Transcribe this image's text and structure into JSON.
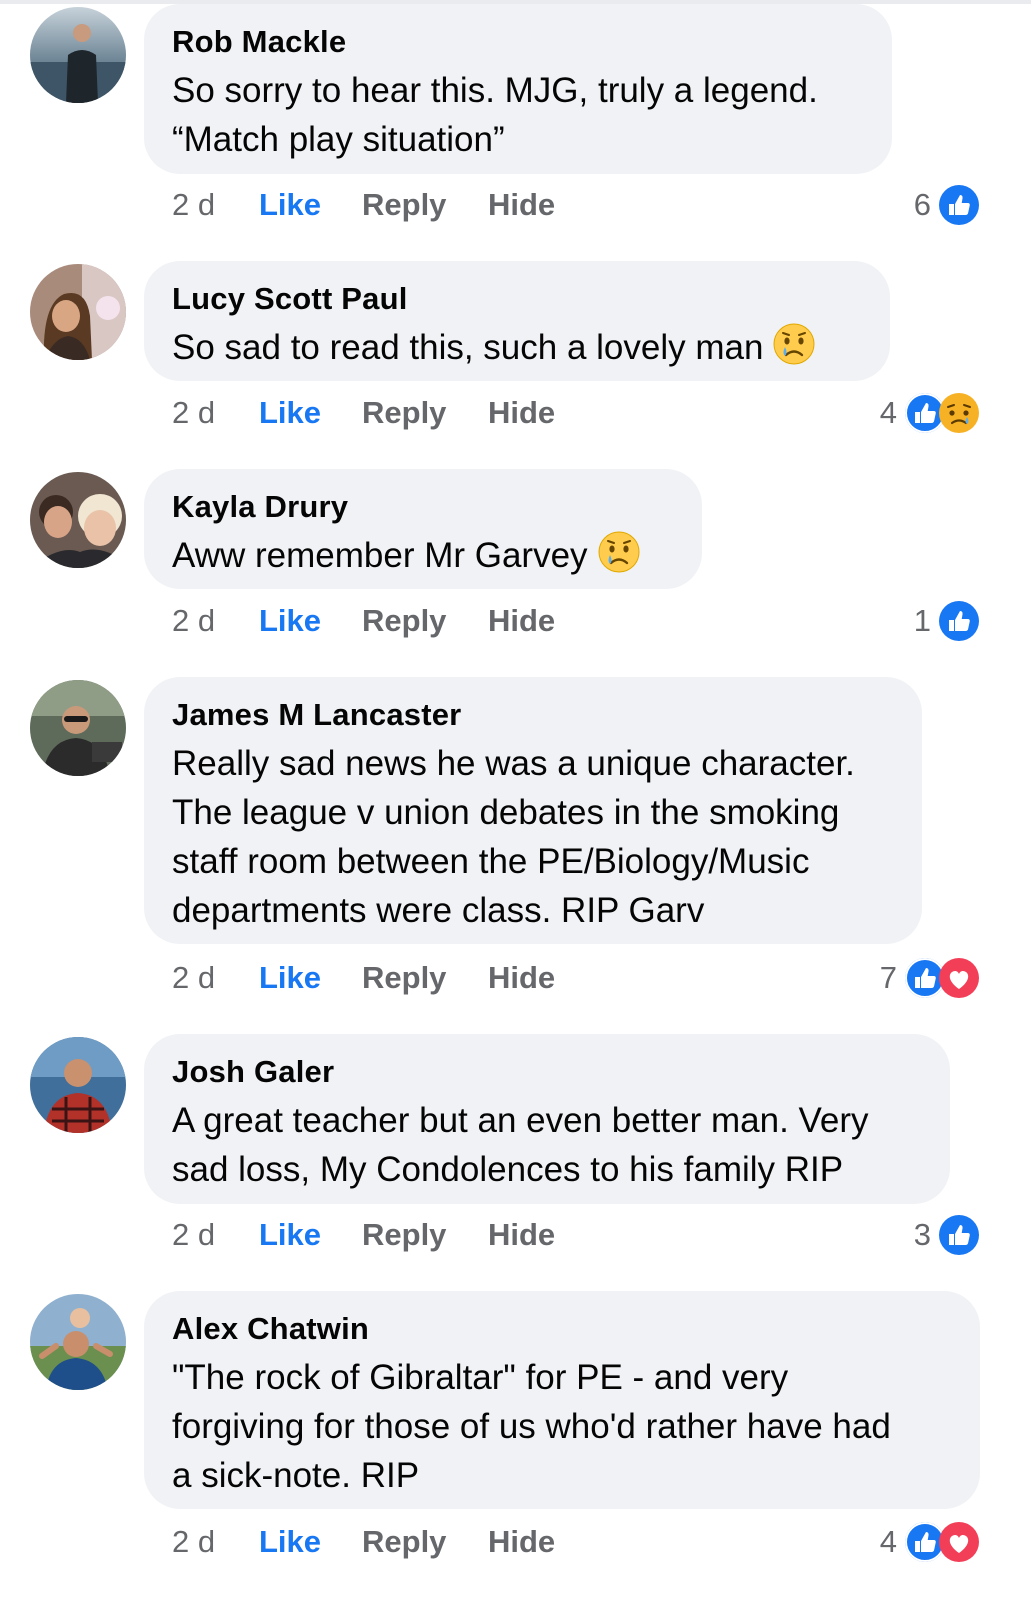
{
  "comments": [
    {
      "author": "Rob Mackle",
      "lines": [
        "So sorry to hear this. MJG, truly a legend.",
        "“Match play situation”"
      ],
      "time": "2 d",
      "like": "Like",
      "reply": "Reply",
      "hide": "Hide",
      "reaction_count": "6",
      "reactions": [
        "like-icon"
      ],
      "body_emoji": null
    },
    {
      "author": "Lucy Scott Paul",
      "lines": [
        "So sad to read this, such a lovely man"
      ],
      "time": "2 d",
      "like": "Like",
      "reply": "Reply",
      "hide": "Hide",
      "reaction_count": "4",
      "reactions": [
        "like-icon",
        "sad-icon"
      ],
      "body_emoji": "crying-face-emoji"
    },
    {
      "author": "Kayla Drury",
      "lines": [
        "Aww remember Mr Garvey"
      ],
      "time": "2 d",
      "like": "Like",
      "reply": "Reply",
      "hide": "Hide",
      "reaction_count": "1",
      "reactions": [
        "like-icon"
      ],
      "body_emoji": "crying-face-emoji"
    },
    {
      "author": "James M Lancaster",
      "lines": [
        "Really sad news he was a unique character.",
        "The league v union debates in the smoking",
        "staff room between the PE/Biology/Music",
        "departments were class. RIP Garv"
      ],
      "time": "2 d",
      "like": "Like",
      "reply": "Reply",
      "hide": "Hide",
      "reaction_count": "7",
      "reactions": [
        "like-icon",
        "love-icon"
      ],
      "body_emoji": null
    },
    {
      "author": "Josh Galer",
      "lines": [
        "A great teacher but an even better man. Very",
        "sad loss, My Condolences to his family RIP"
      ],
      "time": "2 d",
      "like": "Like",
      "reply": "Reply",
      "hide": "Hide",
      "reaction_count": "3",
      "reactions": [
        "like-icon"
      ],
      "body_emoji": null
    },
    {
      "author": "Alex Chatwin",
      "lines": [
        "\"The rock of Gibraltar\" for PE - and very",
        "forgiving for those of us who'd rather have had",
        "a sick-note. RIP"
      ],
      "time": "2 d",
      "like": "Like",
      "reply": "Reply",
      "hide": "Hide",
      "reaction_count": "4",
      "reactions": [
        "like-icon",
        "love-icon"
      ],
      "body_emoji": null
    }
  ],
  "colors": {
    "bubble": "#f0f2f5",
    "like_blue": "#1877f2",
    "love_red": "#f33e58",
    "meta_gray": "#65676b"
  }
}
